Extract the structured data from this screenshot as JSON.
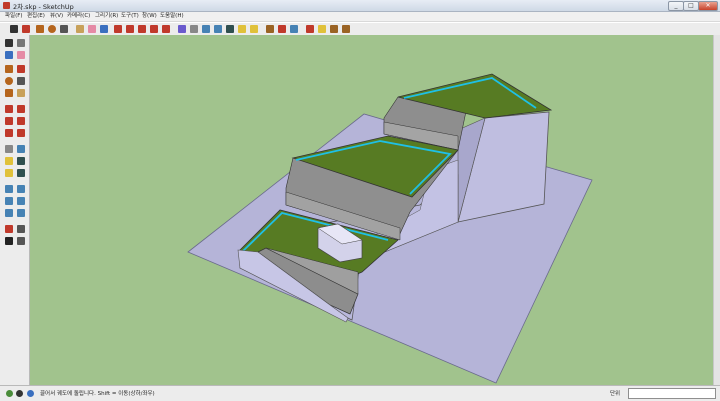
{
  "window": {
    "title": "2차.skp - SketchUp",
    "minimize_label": "_",
    "maximize_label": "□",
    "close_label": "✕"
  },
  "menu": {
    "items": [
      {
        "label": "파일(F)"
      },
      {
        "label": "편집(E)"
      },
      {
        "label": "뷰(V)"
      },
      {
        "label": "카메라(C)"
      },
      {
        "label": "그리기(R)"
      },
      {
        "label": "도구(T)"
      },
      {
        "label": "창(W)"
      },
      {
        "label": "도움말(H)"
      }
    ]
  },
  "toolbar": {
    "icons": [
      "select-icon",
      "pencil-icon",
      "rectangle-icon",
      "circle-icon",
      "arc-icon",
      "polygon-icon",
      "eraser-icon",
      "paint-bucket-icon",
      "push-pull-icon",
      "move-icon",
      "rotate-icon",
      "follow-me-icon",
      "scale-icon",
      "offset-icon",
      "tape-icon",
      "protractor-icon",
      "dimension-icon",
      "text-icon",
      "axes-icon",
      "section-icon",
      "orbit-icon",
      "pan-icon",
      "zoom-icon",
      "zoom-window-icon",
      "zoom-extents-icon",
      "previous-view-icon",
      "next-view-icon",
      "component-icon",
      "group-icon",
      "layers-icon"
    ]
  },
  "status": {
    "message": "끌어서 궤도에 돌립니다.  Shift = 이동(상하/좌우)",
    "measurement_label": "단위",
    "measurement_value": ""
  },
  "colors": {
    "viewport_bg": "#a1c38d",
    "ground_plane": "#b5b4d8",
    "terrace_grass": "#577b23",
    "retaining_wall": "#8e8e8e",
    "water_edge": "#1ec0e6"
  }
}
